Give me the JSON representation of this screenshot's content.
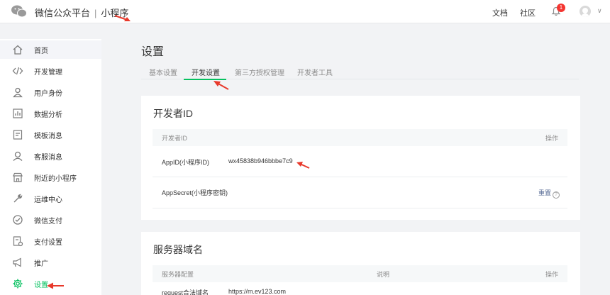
{
  "header": {
    "platform": "微信公众平台",
    "separator": "|",
    "product": "小程序",
    "links": [
      "文档",
      "社区"
    ],
    "notification_count": "1",
    "caret": "∨"
  },
  "sidebar": {
    "items": [
      {
        "label": "首页",
        "icon": "home-icon"
      },
      {
        "label": "开发管理",
        "icon": "code-icon"
      },
      {
        "label": "用户身份",
        "icon": "user-icon"
      },
      {
        "label": "数据分析",
        "icon": "chart-icon"
      },
      {
        "label": "模板消息",
        "icon": "template-icon"
      },
      {
        "label": "客服消息",
        "icon": "customer-service-icon"
      },
      {
        "label": "附近的小程序",
        "icon": "store-icon"
      },
      {
        "label": "运维中心",
        "icon": "wrench-icon"
      },
      {
        "label": "微信支付",
        "icon": "pay-icon"
      },
      {
        "label": "支付设置",
        "icon": "pay-settings-icon"
      },
      {
        "label": "推广",
        "icon": "megaphone-icon"
      },
      {
        "label": "设置",
        "icon": "gear-icon"
      }
    ]
  },
  "main": {
    "title": "设置",
    "tabs": [
      "基本设置",
      "开发设置",
      "第三方授权管理",
      "开发者工具"
    ],
    "developer_card": {
      "title": "开发者ID",
      "columns": [
        "开发者ID",
        "操作"
      ],
      "appid_label": "AppID(小程序ID)",
      "appid_value": "wx45838b946bbbe7c9",
      "appsecret_label": "AppSecret(小程序密钥)",
      "reset_label": "重置",
      "help": "?"
    },
    "server_card": {
      "title": "服务器域名",
      "columns": [
        "服务器配置",
        "说明",
        "操作"
      ],
      "rows": [
        {
          "label": "request合法域名",
          "value": "https://m.ev123.com"
        }
      ]
    }
  },
  "colors": {
    "accent": "#07c160",
    "annotation": "#e8392b",
    "link": "#576b95"
  }
}
